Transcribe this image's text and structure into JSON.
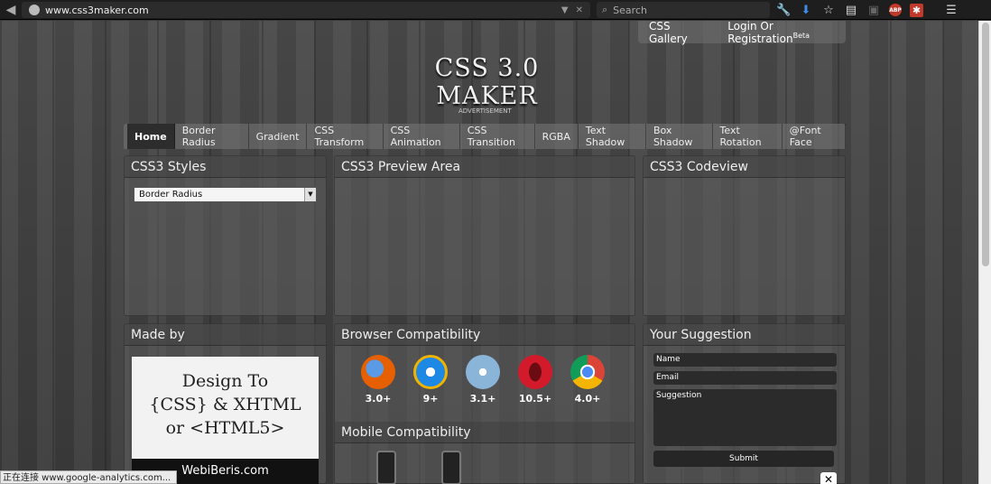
{
  "browser": {
    "url": "www.css3maker.com",
    "search_placeholder": "Search"
  },
  "topnav": {
    "gallery": "CSS Gallery",
    "login": "Login Or Registration",
    "beta": "Beta"
  },
  "logo": "CSS 3.0 MAKER",
  "advertisement": "ADVERTISEMENT",
  "tabs": [
    "Home",
    "Border Radius",
    "Gradient",
    "CSS Transform",
    "CSS Animation",
    "CSS Transition",
    "RGBA",
    "Text Shadow",
    "Box Shadow",
    "Text Rotation",
    "@Font Face"
  ],
  "panels": {
    "styles": {
      "title": "CSS3 Styles",
      "selected": "Border Radius"
    },
    "preview": {
      "title": "CSS3 Preview Area"
    },
    "codeview": {
      "title": "CSS3 Codeview"
    },
    "madeby": {
      "title": "Made by",
      "line1": "Design To",
      "line2": "{CSS} & XHTML",
      "line3": "or  <HTML5>",
      "strip": "WebiBeris.com"
    },
    "compat": {
      "title": "Browser Compatibility",
      "browsers": [
        {
          "name": "firefox-icon",
          "ver": "3.0+",
          "color": "#e66000"
        },
        {
          "name": "ie-icon",
          "ver": "9+",
          "color": "#1e88e5"
        },
        {
          "name": "safari-icon",
          "ver": "3.1+",
          "color": "#8ab4d8"
        },
        {
          "name": "opera-icon",
          "ver": "10.5+",
          "color": "#d21a2a"
        },
        {
          "name": "chrome-icon",
          "ver": "4.0+",
          "color": "#4caf50"
        }
      ],
      "mobile_title": "Mobile Compatibility"
    },
    "suggestion": {
      "title": "Your Suggestion",
      "name": "Name",
      "email": "Email",
      "suggestion": "Suggestion",
      "submit": "Submit"
    }
  },
  "status_text": "正在连接 www.google-analytics.com..."
}
